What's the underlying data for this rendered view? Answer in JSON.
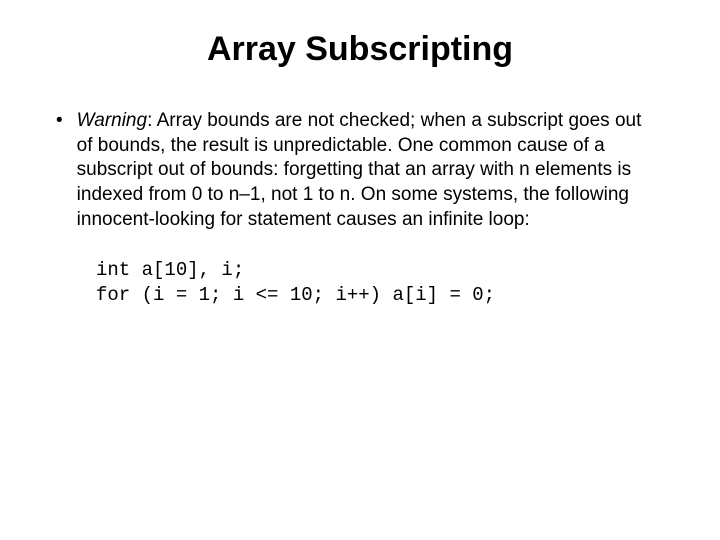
{
  "title": "Array Subscripting",
  "bullet": {
    "marker": "•",
    "warning_label": "Warning",
    "text": ": Array bounds are not checked; when a subscript goes out of bounds, the result is unpredictable. One common cause of a subscript out of bounds: forgetting that an array with n elements is indexed from 0 to n–1, not 1 to n. On some systems, the following innocent-looking for statement causes an infinite loop:"
  },
  "code": "int a[10], i;\nfor (i = 1; i <= 10; i++) a[i] = 0;"
}
